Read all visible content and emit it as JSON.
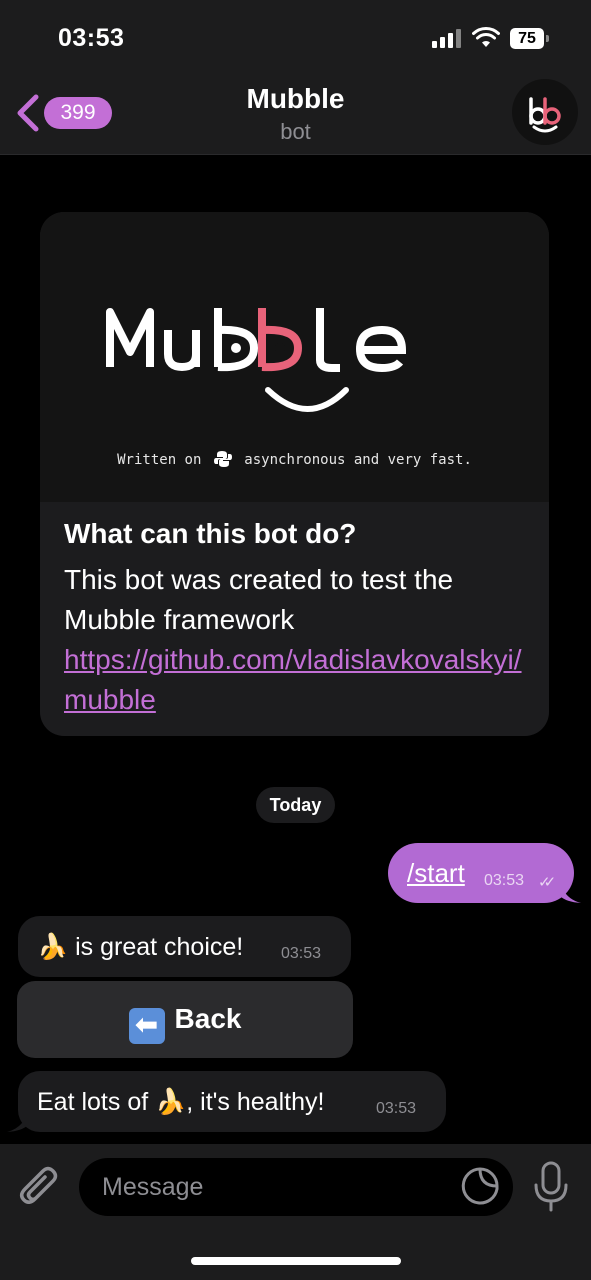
{
  "status": {
    "time": "03:53",
    "battery": "75",
    "icons": [
      "cellular-signal-icon",
      "wifi-icon",
      "battery-icon"
    ]
  },
  "header": {
    "back_count": "399",
    "title": "Mubble",
    "subtitle": "bot"
  },
  "bot_info": {
    "logo_text": "Mubble",
    "logo_tagline_before": "Written on",
    "logo_tagline_after": "asynchronous and very fast.",
    "heading": "What can this bot do?",
    "description": "This bot was created to test the Mubble framework",
    "link": "https://github.com/vladislavkovalskyi/mubble"
  },
  "date_divider": "Today",
  "messages": [
    {
      "direction": "out",
      "text": "/start",
      "time": "03:53",
      "status": "read"
    },
    {
      "direction": "in",
      "emoji": "🍌",
      "text": " is great choice!",
      "time": "03:53"
    },
    {
      "direction": "in",
      "text_before": "Eat lots of ",
      "emoji": "🍌",
      "text_after": ", it's healthy!",
      "time": "03:53"
    }
  ],
  "keyboard": {
    "button_icon": "⬅",
    "button_label": "Back"
  },
  "composer": {
    "placeholder": "Message"
  },
  "colors": {
    "accent": "#c36fd6",
    "outgoing_bubble": "#b26ad3",
    "incoming_bubble": "#1c1c1e",
    "logo_accent": "#e8637a"
  }
}
